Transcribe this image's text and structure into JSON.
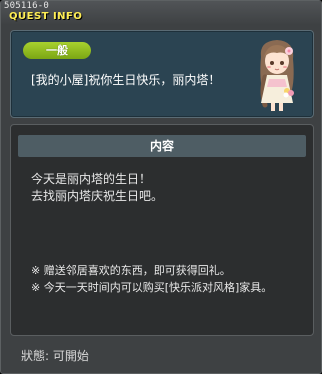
{
  "window": {
    "quest_id": "505116-0",
    "title": "QUEST INFO"
  },
  "header": {
    "category": "一般",
    "quest_title": "[我的小屋]祝你生日快乐，丽内塔！",
    "npc_icon": "npc-portrait-icon"
  },
  "content": {
    "section_title": "内容",
    "description": [
      "今天是丽内塔的生日！",
      "去找丽内塔庆祝生日吧。"
    ],
    "notes": [
      "※  赠送邻居喜欢的东西，即可获得回礼。",
      "※  今天一天时间内可以购买[快乐派对风格]家具。"
    ]
  },
  "footer": {
    "status": "狀態:  可開始"
  },
  "colors": {
    "title_yellow": "#ffee55",
    "category_green": "#8cbc1c",
    "header_bg": "#2b4452"
  }
}
